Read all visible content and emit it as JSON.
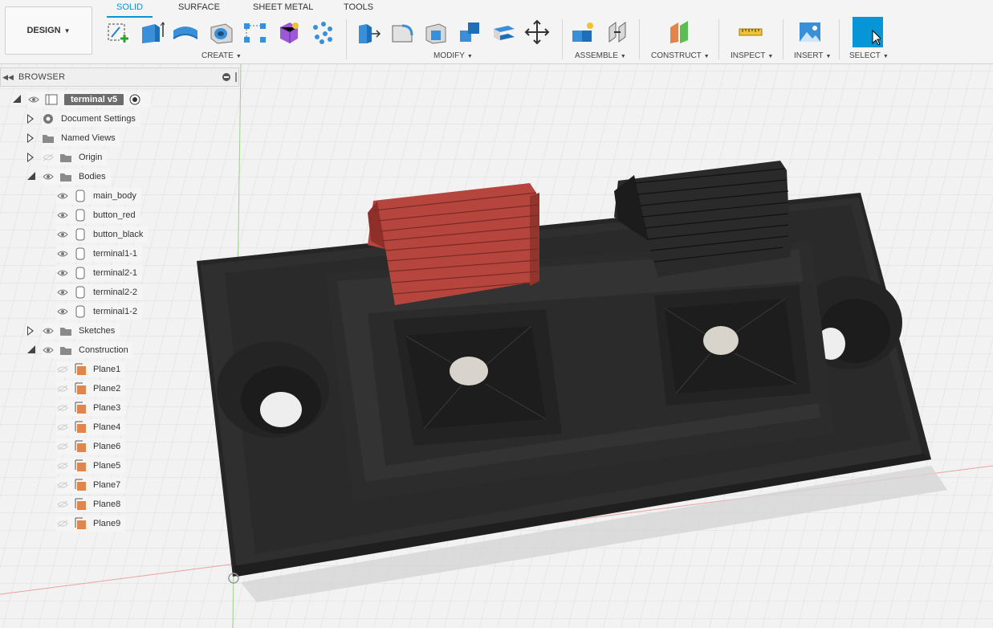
{
  "workspace": {
    "label": "DESIGN"
  },
  "tabs": [
    {
      "label": "SOLID",
      "active": true
    },
    {
      "label": "SURFACE",
      "active": false
    },
    {
      "label": "SHEET METAL",
      "active": false
    },
    {
      "label": "TOOLS",
      "active": false
    }
  ],
  "groups": {
    "create": "CREATE",
    "modify": "MODIFY",
    "assemble": "ASSEMBLE",
    "construct": "CONSTRUCT",
    "inspect": "INSPECT",
    "insert": "INSERT",
    "select": "SELECT"
  },
  "tools": {
    "create": [
      "new-sketch-icon",
      "extrude-icon",
      "revolve-icon",
      "hole-icon",
      "pattern-icon",
      "form-icon",
      "point-cloud-icon"
    ],
    "modify": [
      "press-pull-icon",
      "fillet-icon",
      "shell-icon",
      "combine-icon",
      "offset-face-icon",
      "move-icon"
    ],
    "assemble": [
      "new-component-icon",
      "joint-icon"
    ],
    "construct": [
      "offset-plane-icon"
    ],
    "inspect": [
      "measure-icon"
    ],
    "insert": [
      "insert-image-icon"
    ],
    "select": [
      "select-cursor-icon"
    ]
  },
  "browser": {
    "title": "BROWSER",
    "root": "terminal v5",
    "document_settings": "Document Settings",
    "named_views": "Named Views",
    "origin": "Origin",
    "bodies": {
      "label": "Bodies",
      "items": [
        "main_body",
        "button_red",
        "button_black",
        "terminal1-1",
        "terminal2-1",
        "terminal2-2",
        "terminal1-2"
      ]
    },
    "sketches": "Sketches",
    "construction": {
      "label": "Construction",
      "items": [
        "Plane1",
        "Plane2",
        "Plane3",
        "Plane4",
        "Plane6",
        "Plane5",
        "Plane7",
        "Plane8",
        "Plane9"
      ]
    }
  },
  "colors": {
    "accent": "#0696d7",
    "body_dark": "#2b2b2b",
    "button_red": "#b6463d",
    "plane_orange": "#e0864c"
  }
}
